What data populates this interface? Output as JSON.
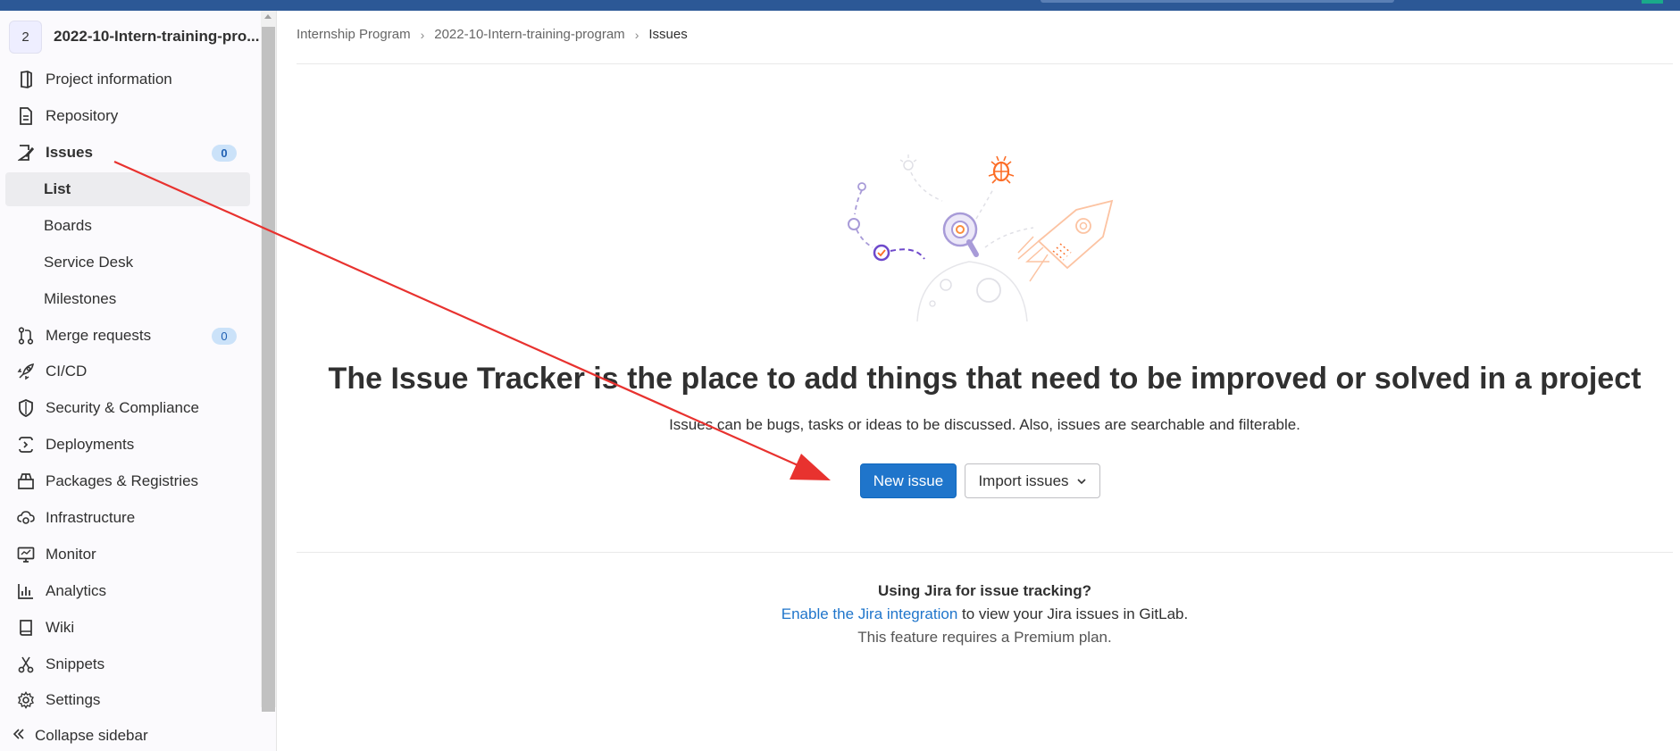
{
  "colors": {
    "topbar": "#2c5896",
    "primary": "#1f75cb",
    "link": "#1f75cb",
    "badge_bg": "#cbe2f9",
    "annotation_arrow": "#e8322f"
  },
  "sidebar": {
    "project_avatar": "2",
    "project_name": "2022-10-Intern-training-pro...",
    "items": [
      {
        "label": "Project information",
        "icon": "project-info-icon"
      },
      {
        "label": "Repository",
        "icon": "document-icon"
      },
      {
        "label": "Issues",
        "icon": "issues-icon",
        "badge": "0"
      },
      {
        "label": "List"
      },
      {
        "label": "Boards"
      },
      {
        "label": "Service Desk"
      },
      {
        "label": "Milestones"
      },
      {
        "label": "Merge requests",
        "icon": "merge-request-icon",
        "badge": "0"
      },
      {
        "label": "CI/CD",
        "icon": "rocket-icon"
      },
      {
        "label": "Security & Compliance",
        "icon": "shield-icon"
      },
      {
        "label": "Deployments",
        "icon": "deployments-icon"
      },
      {
        "label": "Packages & Registries",
        "icon": "package-icon"
      },
      {
        "label": "Infrastructure",
        "icon": "cloud-gear-icon"
      },
      {
        "label": "Monitor",
        "icon": "monitor-icon"
      },
      {
        "label": "Analytics",
        "icon": "chart-icon"
      },
      {
        "label": "Wiki",
        "icon": "book-icon"
      },
      {
        "label": "Snippets",
        "icon": "scissors-icon"
      },
      {
        "label": "Settings",
        "icon": "gear-icon"
      }
    ],
    "collapse_label": "Collapse sidebar"
  },
  "breadcrumb": {
    "items": [
      "Internship Program",
      "2022-10-Intern-training-program",
      "Issues"
    ]
  },
  "empty_state": {
    "title": "The Issue Tracker is the place to add things that need to be improved or solved in a project",
    "description": "Issues can be bugs, tasks or ideas to be discussed. Also, issues are searchable and filterable.",
    "new_issue_label": "New issue",
    "import_issues_label": "Import issues"
  },
  "jira": {
    "title": "Using Jira for issue tracking?",
    "link_text": "Enable the Jira integration",
    "line_suffix": " to view your Jira issues in GitLab.",
    "note": "This feature requires a Premium plan."
  }
}
